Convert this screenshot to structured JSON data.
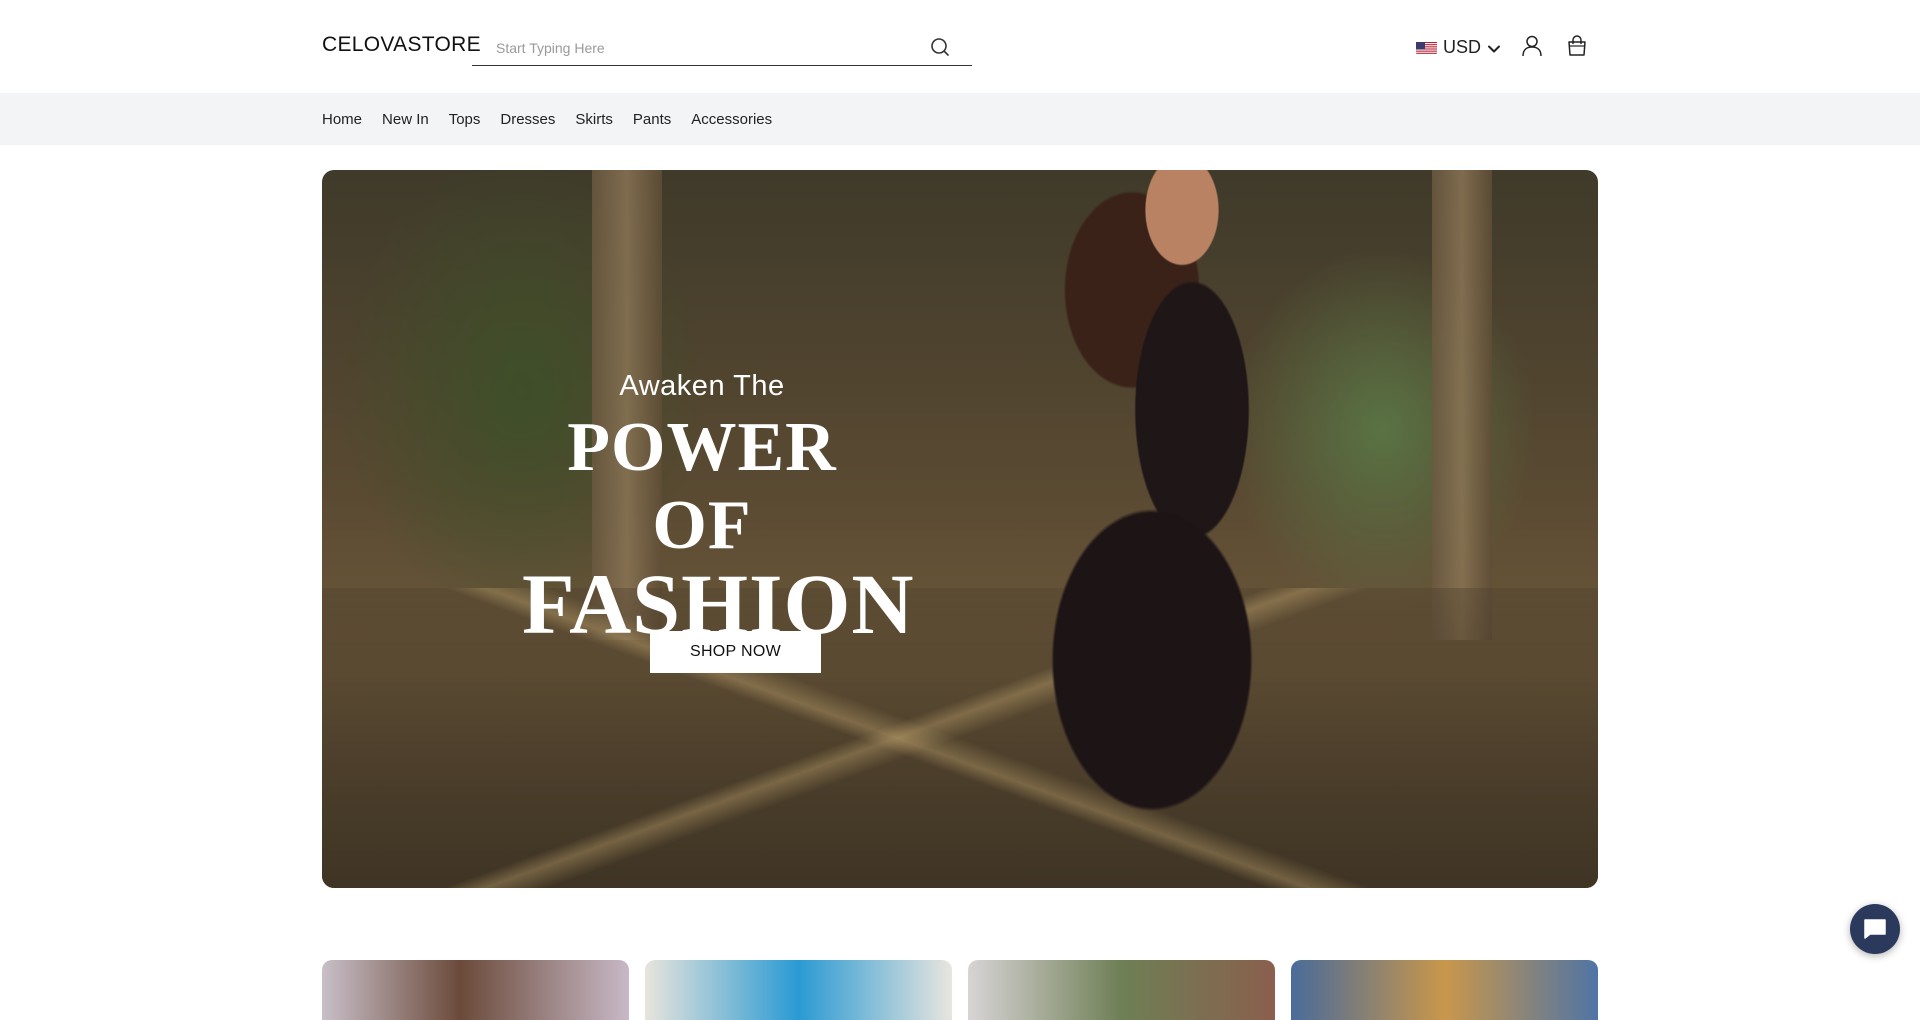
{
  "header": {
    "logo": "CELOVASTORE",
    "search": {
      "placeholder": "Start Typing Here",
      "value": "",
      "icon": "search-icon"
    },
    "currency": {
      "flag": "us-flag-icon",
      "label": "USD",
      "icon": "chevron-down-icon"
    },
    "account_icon": "user-icon",
    "cart_icon": "shopping-bag-icon"
  },
  "nav": {
    "items": [
      {
        "label": "Home"
      },
      {
        "label": "New In"
      },
      {
        "label": "Tops"
      },
      {
        "label": "Dresses"
      },
      {
        "label": "Skirts"
      },
      {
        "label": "Pants"
      },
      {
        "label": "Accessories"
      }
    ]
  },
  "hero": {
    "subtitle": "Awaken The",
    "title_line1": "POWER OF",
    "title_line2": "FASHION",
    "cta_label": "SHOP NOW"
  },
  "chat": {
    "icon": "chat-bubble-icon"
  },
  "colors": {
    "nav_bg": "#f3f4f6",
    "text": "#1a1a1a",
    "chat_bg": "#2b3a5c",
    "button_bg": "#ffffff"
  }
}
